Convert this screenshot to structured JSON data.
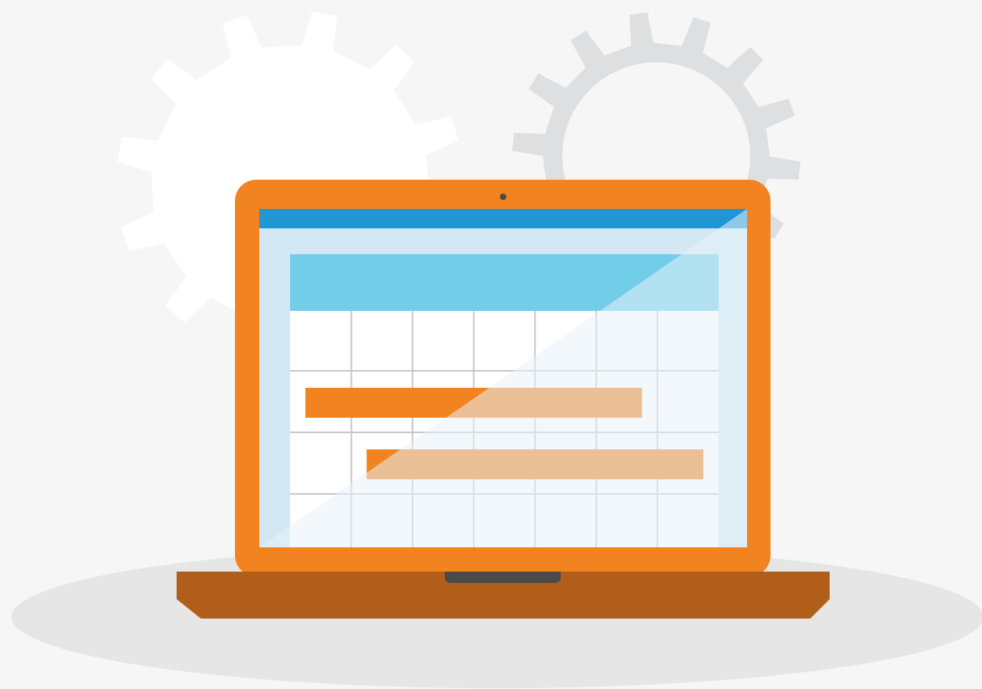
{
  "colors": {
    "background": "#f6f6f6",
    "floor_shadow": "#e6e6e6",
    "gear_large": "#ffffff",
    "gear_small": "#dedfe0",
    "laptop_bezel": "#f28321",
    "laptop_base": "#b05e19",
    "trackpad_notch": "#4a4a4a",
    "webcam": "#4a4a4a",
    "screen_title_bar": "#2196d4",
    "screen_bg": "#d3e8f4",
    "calendar_header": "#72cde9",
    "calendar_grid_bg": "#ffffff",
    "calendar_grid_lines": "#c8c8c8",
    "task_bar": "#f28321"
  },
  "icons": {
    "gear_large": "gear-icon",
    "gear_small": "gear-icon",
    "laptop": "laptop-icon",
    "calendar": "calendar-icon"
  },
  "gantt": {
    "columns": 7,
    "rows": 4,
    "tasks": [
      {
        "start_col": 0.25,
        "end_col": 5.75,
        "row": 1
      },
      {
        "start_col": 1.25,
        "end_col": 6.75,
        "row": 2
      }
    ]
  }
}
